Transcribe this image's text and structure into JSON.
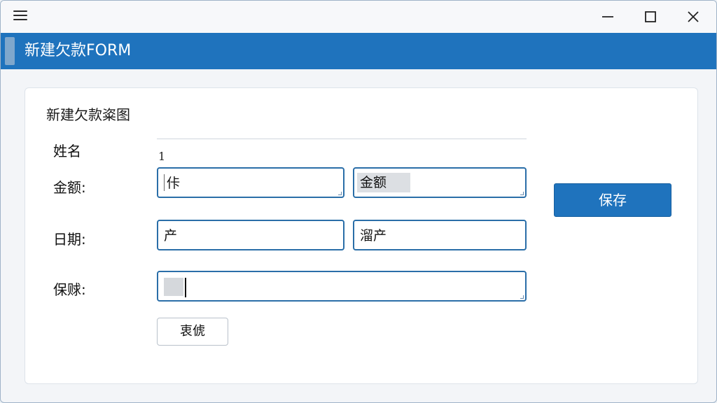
{
  "window": {
    "title": "新建欠款FORM",
    "controls": [
      "minimize-icon",
      "maximize-icon",
      "close-icon"
    ]
  },
  "form": {
    "heading": "新建欠款粢图",
    "number": "1",
    "labels": {
      "name": "姓名",
      "amount": "金额:",
      "date": "日期:",
      "guarantee": "保赇:"
    },
    "fields": {
      "amount_left": "佧",
      "amount_right": "金额",
      "date_left": "产",
      "date_right": "溜产",
      "guarantee": ""
    },
    "buttons": {
      "save": "保存",
      "secondary": "衷俿"
    }
  },
  "colors": {
    "header": "#1f73bd",
    "button": "#1f73bd",
    "field_border": "#2a6ea8"
  }
}
